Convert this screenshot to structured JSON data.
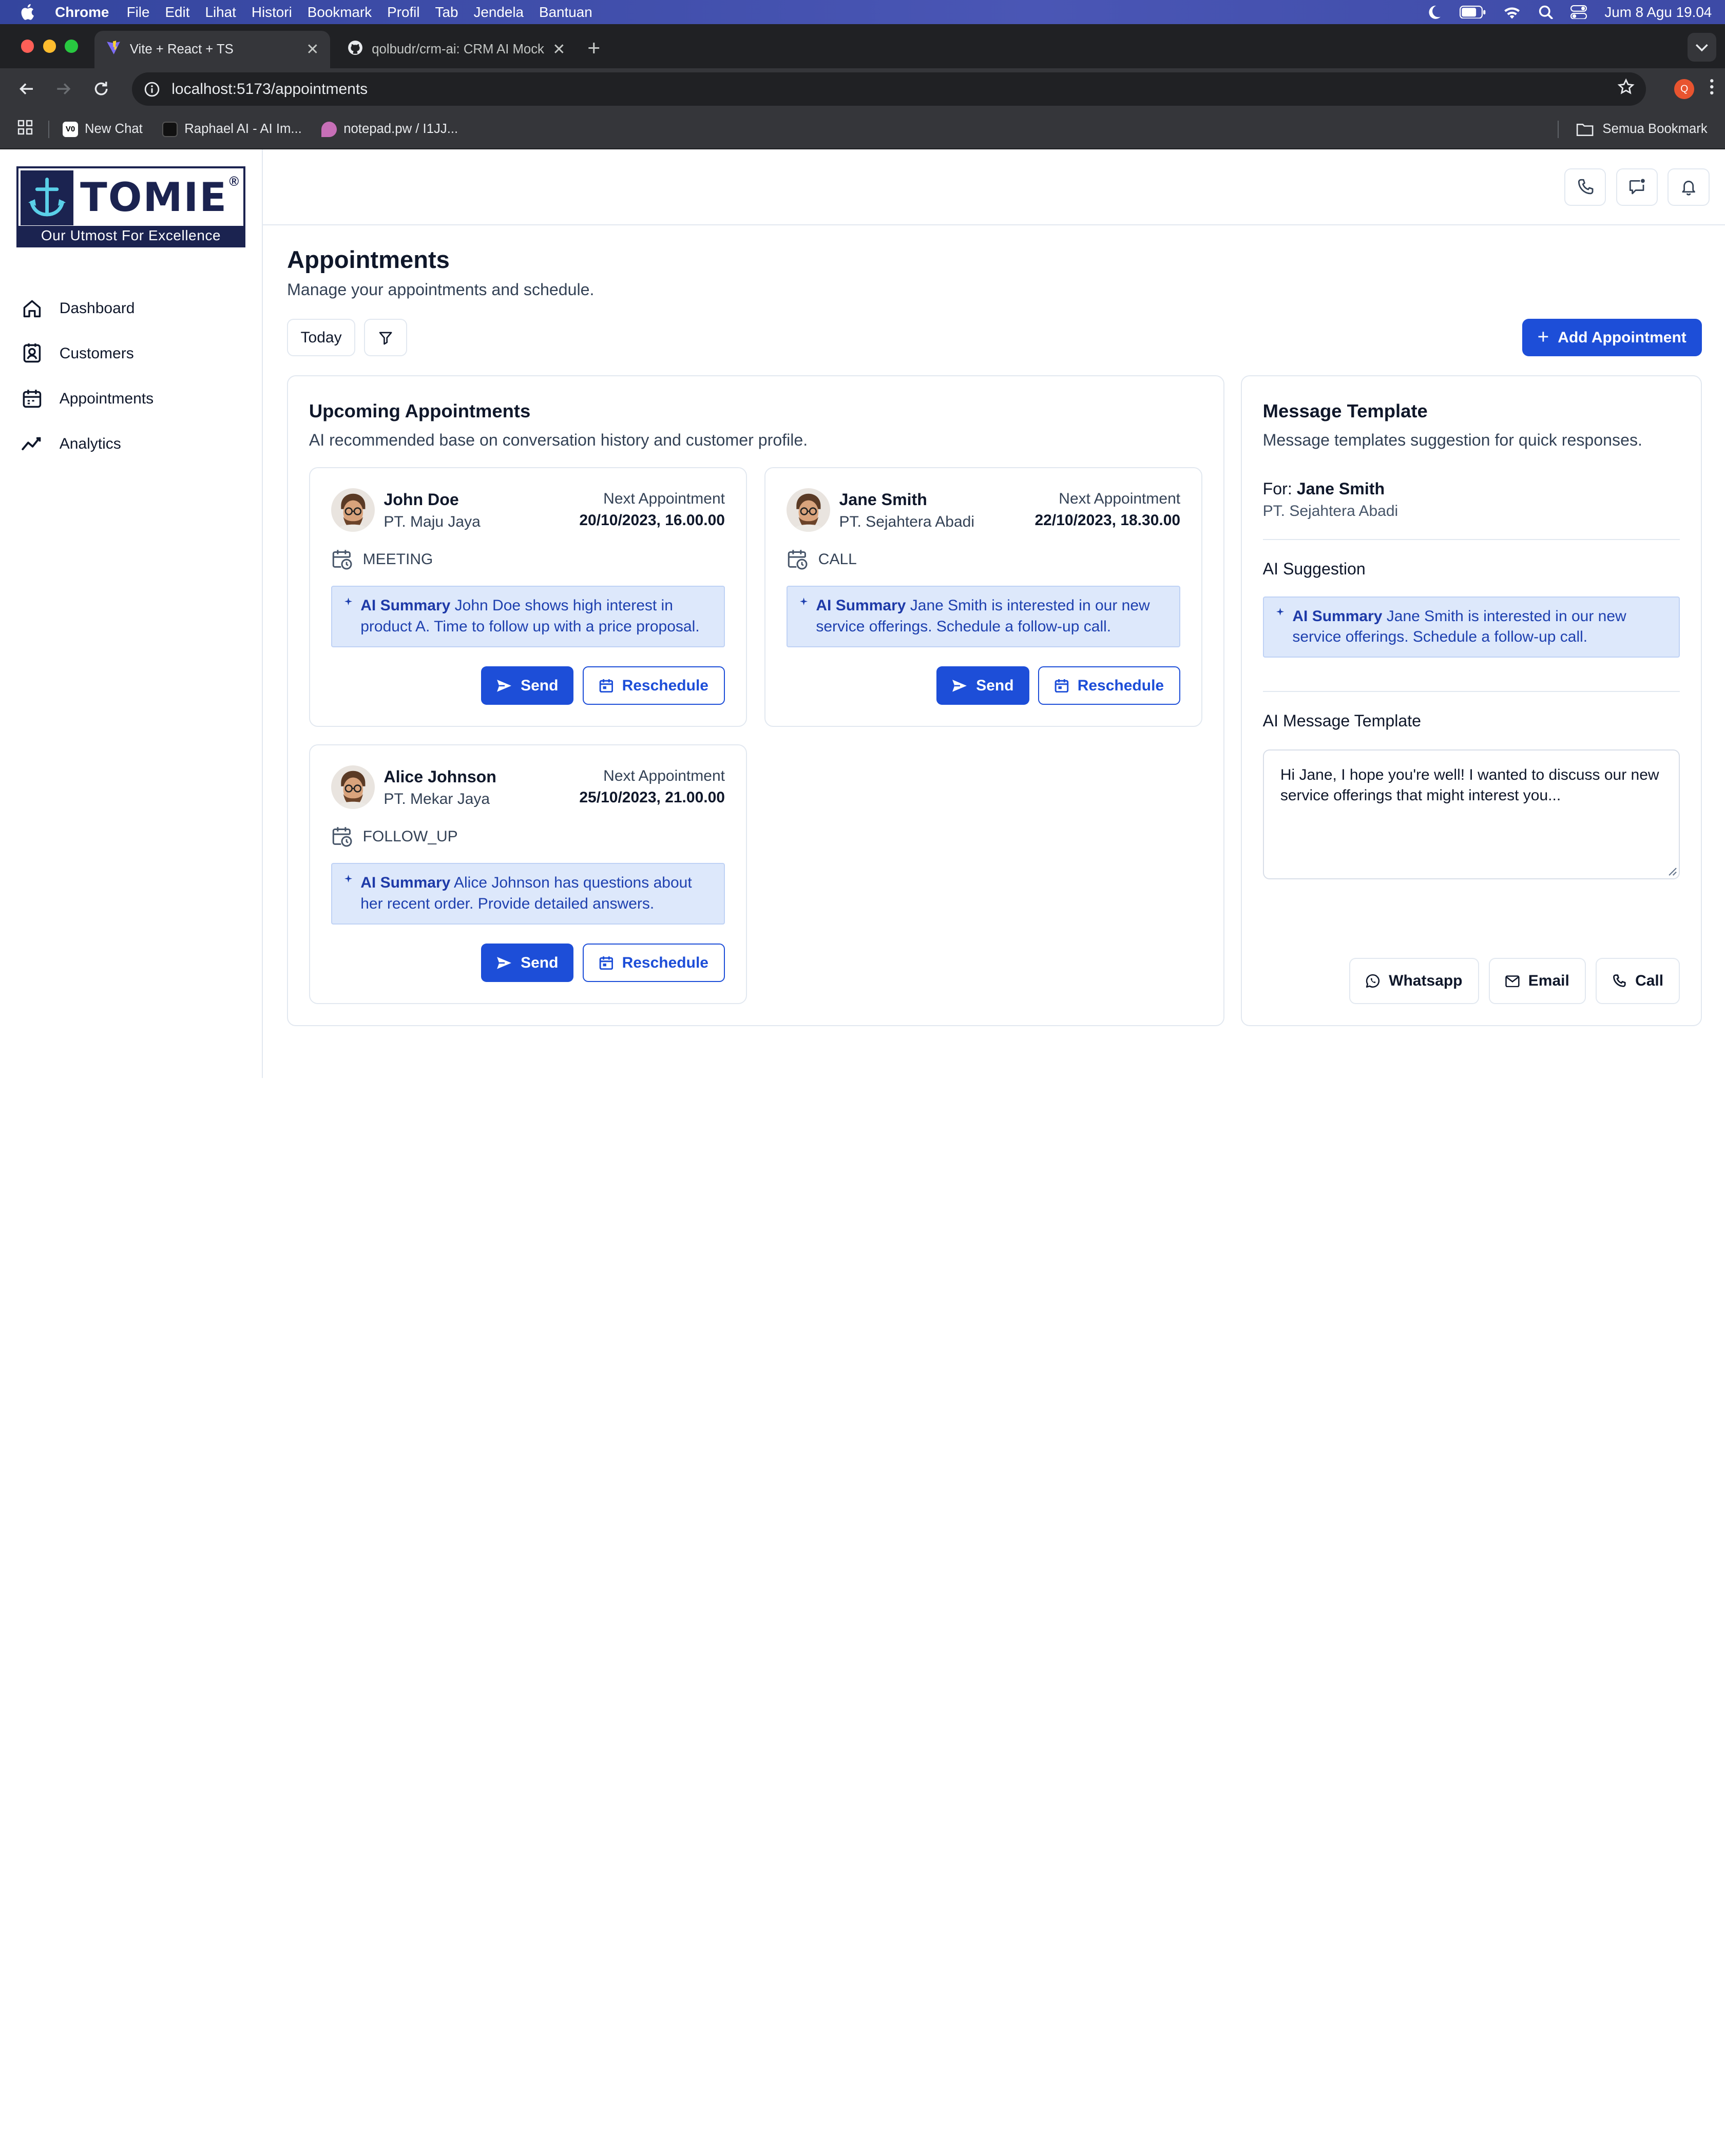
{
  "menubar": {
    "app": "Chrome",
    "items": [
      "File",
      "Edit",
      "Lihat",
      "Histori",
      "Bookmark",
      "Profil",
      "Tab",
      "Jendela",
      "Bantuan"
    ],
    "clock": "Jum 8 Agu  19.04"
  },
  "browser": {
    "tabs": [
      {
        "title": "Vite + React + TS",
        "active": true
      },
      {
        "title": "qolbudr/crm-ai: CRM AI Mock",
        "active": false
      }
    ],
    "url": "localhost:5173/appointments",
    "profile_initial": "Q",
    "bookmarks": [
      "New Chat",
      "Raphael AI - AI Im...",
      "notepad.pw / I1JJ..."
    ],
    "all_bookmarks": "Semua Bookmark"
  },
  "brand": {
    "name": "TOMIE",
    "reg": "®",
    "tagline": "Our Utmost For Excellence",
    "color": "#1b2350"
  },
  "sidebar": {
    "items": [
      {
        "label": "Dashboard",
        "icon": "home-icon"
      },
      {
        "label": "Customers",
        "icon": "contact-icon"
      },
      {
        "label": "Appointments",
        "icon": "calendar-icon"
      },
      {
        "label": "Analytics",
        "icon": "trend-icon"
      }
    ]
  },
  "page": {
    "title": "Appointments",
    "subtitle": "Manage your appointments and schedule.",
    "today_label": "Today",
    "add_label": "Add Appointment"
  },
  "upcoming": {
    "title": "Upcoming Appointments",
    "subtitle": "AI recommended base on conversation history and customer profile.",
    "next_label": "Next Appointment",
    "ai_label": "AI Summary",
    "send_label": "Send",
    "reschedule_label": "Reschedule",
    "cards": [
      {
        "name": "John Doe",
        "company": "PT. Maju Jaya",
        "date": "20/10/2023, 16.00.00",
        "type": "MEETING",
        "summary": "John Doe shows high interest in product A. Time to follow up with a price proposal."
      },
      {
        "name": "Jane Smith",
        "company": "PT. Sejahtera Abadi",
        "date": "22/10/2023, 18.30.00",
        "type": "CALL",
        "summary": "Jane Smith is interested in our new service offerings. Schedule a follow-up call."
      },
      {
        "name": "Alice Johnson",
        "company": "PT. Mekar Jaya",
        "date": "25/10/2023, 21.00.00",
        "type": "FOLLOW_UP",
        "summary": "Alice Johnson has questions about her recent order. Provide detailed answers."
      }
    ]
  },
  "template": {
    "title": "Message Template",
    "subtitle": "Message templates suggestion for quick responses.",
    "for_prefix": "For:",
    "for_name": "Jane Smith",
    "for_company": "PT. Sejahtera Abadi",
    "suggestion_title": "AI Suggestion",
    "ai_label": "AI Summary",
    "suggestion": "Jane Smith is interested in our new service offerings. Schedule a follow-up call.",
    "message_title": "AI Message Template",
    "message": "Hi Jane, I hope you're well! I wanted to discuss our new service offerings that might interest you...",
    "actions": [
      "Whatsapp",
      "Email",
      "Call"
    ]
  },
  "colors": {
    "primary": "#1d4ed8",
    "ai_bg": "#dde8fb"
  }
}
